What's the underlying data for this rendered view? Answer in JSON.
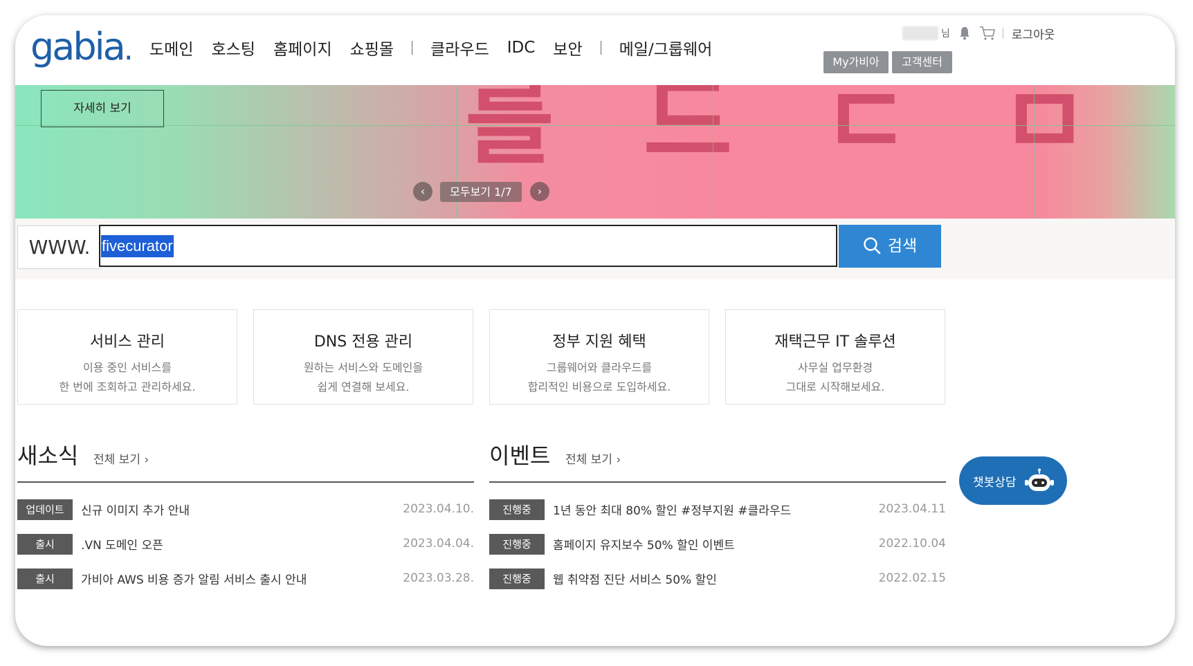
{
  "header": {
    "logo_text": "gabia",
    "nav": [
      "도메인",
      "호스팅",
      "홈페이지",
      "쇼핑몰",
      "클라우드",
      "IDC",
      "보안",
      "메일/그룹웨어"
    ],
    "util": {
      "suffix": "님",
      "logout": "로그아웃",
      "my_gabia": "My가비아",
      "support": "고객센터"
    }
  },
  "banner": {
    "detail_button": "자세히 보기",
    "counter": "모두보기  1/7",
    "prev_icon": "chevron-left-icon",
    "next_icon": "chevron-right-icon"
  },
  "search": {
    "prefix": "WWW.",
    "value": "fivecurator",
    "button": "검색"
  },
  "cards": [
    {
      "title": "서비스 관리",
      "line1": "이용 중인 서비스를",
      "line2": "한 번에 조회하고 관리하세요."
    },
    {
      "title": "DNS 전용 관리",
      "line1": "원하는 서비스와 도메인을",
      "line2": "쉽게 연결해 보세요."
    },
    {
      "title": "정부 지원 혜택",
      "line1": "그룹웨어와 클라우드를",
      "line2": "합리적인 비용으로 도입하세요."
    },
    {
      "title": "재택근무 IT 솔루션",
      "line1": "사무실 업무환경",
      "line2": "그대로 시작해보세요."
    }
  ],
  "news": {
    "title": "새소식",
    "more": "전체 보기 ›",
    "items": [
      {
        "badge": "업데이트",
        "text": "신규 이미지 추가 안내",
        "date": "2023.04.10."
      },
      {
        "badge": "출시",
        "text": ".VN 도메인 오픈",
        "date": "2023.04.04."
      },
      {
        "badge": "출시",
        "text": "가비아 AWS 비용 증가 알림 서비스 출시 안내",
        "date": "2023.03.28."
      }
    ]
  },
  "events": {
    "title": "이벤트",
    "more": "전체 보기 ›",
    "items": [
      {
        "badge": "진행중",
        "text": "1년 동안 최대 80% 할인 #정부지원 #클라우드",
        "date": "2023.04.11"
      },
      {
        "badge": "진행중",
        "text": "홈페이지 유지보수 50% 할인 이벤트",
        "date": "2022.10.04"
      },
      {
        "badge": "진행중",
        "text": "웹 취약점 진단 서비스 50% 할인",
        "date": "2022.02.15"
      }
    ]
  },
  "chatbot": {
    "label": "챗봇상담",
    "icon": "robot-icon"
  },
  "colors": {
    "brand": "#1f5fa8",
    "search_button": "#2f87d4",
    "badge": "#595959",
    "chatbot": "#1f6fb6",
    "selection": "#1c5fd6"
  }
}
